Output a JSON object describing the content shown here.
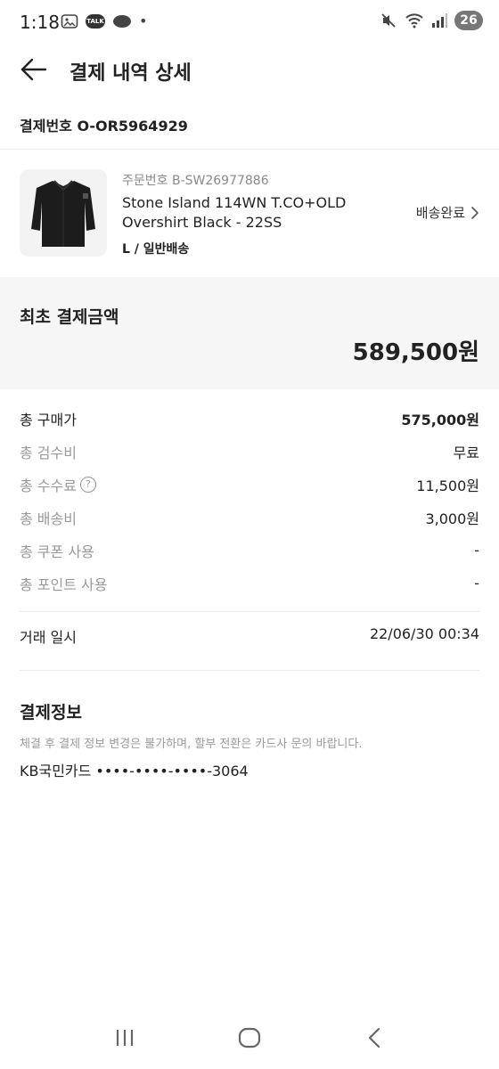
{
  "status_bar": {
    "time": "1:18",
    "talk_badge": "TALK",
    "dot": "•",
    "battery": "26"
  },
  "header": {
    "title": "결제 내역 상세"
  },
  "payment_number": "결제번호 O-OR5964929",
  "product": {
    "order_number": "주문번호 B-SW26977886",
    "name": "Stone Island 114WN T.CO+OLD Overshirt Black - 22SS",
    "option": "L / 일반배송",
    "shipping_status": "배송완료"
  },
  "initial_payment": {
    "label": "최초 결제금액",
    "amount": "589,500원"
  },
  "breakdown": [
    {
      "label": "총 구매가",
      "value": "575,000원"
    },
    {
      "label": "총 검수비",
      "value": "무료"
    },
    {
      "label": "총 수수료",
      "value": "11,500원",
      "help": "?"
    },
    {
      "label": "총 배송비",
      "value": "3,000원"
    },
    {
      "label": "총 쿠폰 사용",
      "value": "-"
    },
    {
      "label": "총 포인트 사용",
      "value": "-"
    }
  ],
  "trade_date": {
    "label": "거래 일시",
    "value": "22/06/30 00:34"
  },
  "payment_info": {
    "title": "결제정보",
    "note": "체결 후 결제 정보 변경은 불가하며, 할부 전환은 카드사 문의 바랍니다.",
    "card": "KB국민카드 ••••-••••-••••-3064"
  },
  "icons": {
    "back": "back-arrow-icon",
    "chevron": "chevron-right-icon",
    "recents": "recents-icon",
    "home": "home-icon",
    "nav_back": "nav-back-icon"
  }
}
